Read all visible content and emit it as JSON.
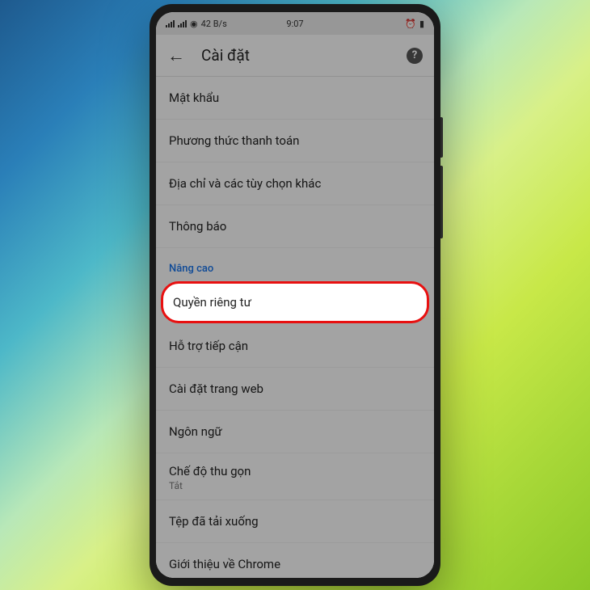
{
  "statusBar": {
    "networkSpeed": "42 B/s",
    "time": "9:07"
  },
  "appBar": {
    "title": "Cài đặt"
  },
  "settings": {
    "items": [
      {
        "label": "Mật khẩu"
      },
      {
        "label": "Phương thức thanh toán"
      },
      {
        "label": "Địa chỉ và các tùy chọn khác"
      },
      {
        "label": "Thông báo"
      }
    ],
    "advancedHeader": "Nâng cao",
    "advancedItems": [
      {
        "label": "Quyền riêng tư",
        "highlighted": true
      },
      {
        "label": "Hỗ trợ tiếp cận"
      },
      {
        "label": "Cài đặt trang web"
      },
      {
        "label": "Ngôn ngữ"
      },
      {
        "label": "Chế độ thu gọn",
        "subLabel": "Tắt"
      },
      {
        "label": "Tệp đã tải xuống"
      },
      {
        "label": "Giới thiệu về Chrome"
      }
    ]
  }
}
